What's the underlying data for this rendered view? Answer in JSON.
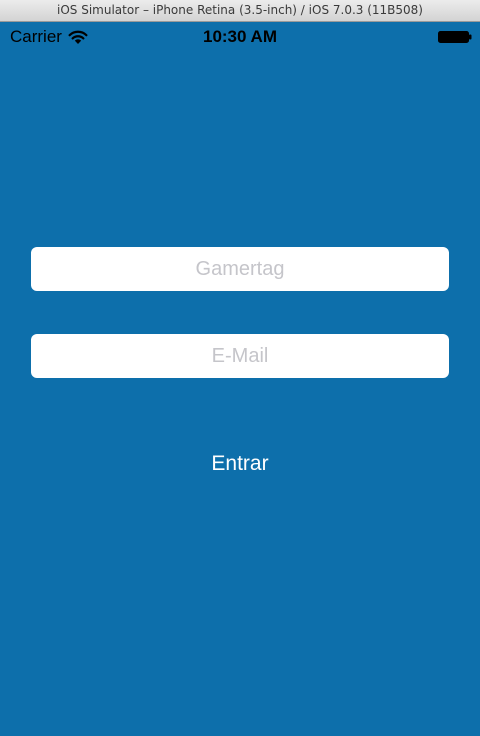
{
  "window": {
    "title": "iOS Simulator – iPhone Retina (3.5-inch) / iOS 7.0.3 (11B508)"
  },
  "status_bar": {
    "carrier": "Carrier",
    "time": "10:30 AM",
    "icons": [
      "wifi-icon",
      "battery-icon"
    ]
  },
  "form": {
    "gamertag_placeholder": "Gamertag",
    "gamertag_value": "",
    "email_placeholder": "E-Mail",
    "email_value": "",
    "submit_label": "Entrar"
  },
  "colors": {
    "background": "#0d6fab",
    "field_background": "#ffffff",
    "placeholder": "#c5c5ca",
    "button_text": "#ffffff"
  }
}
